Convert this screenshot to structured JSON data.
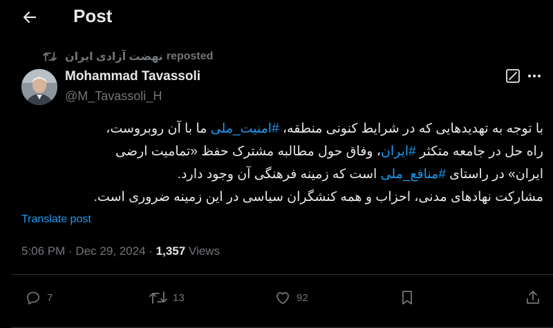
{
  "header": {
    "title": "Post"
  },
  "repost": {
    "label": "reposted",
    "by": "نهضت آزادی ایران"
  },
  "author": {
    "name": "Mohammad Tavassoli",
    "handle": "@M_Tavassoli_H"
  },
  "post": {
    "line1_a": "با توجه به تهدیدهایی که در شرایط کنونی منطقه، ",
    "line1_tag": "#امنیت_ملی",
    "line1_b": " ما با آن روبروست،",
    "line2_a": "راه حل در جامعه متکثر ",
    "line2_tag": "#ایران",
    "line2_b": "، وفاق حول مطالبه مشترک حفظ «تمامیت ارضی",
    "line3_a": "ایران» در راستای ",
    "line3_tag": "#منافع_ملی",
    "line3_b": " است که زمینه فرهنگی آن وجود دارد.",
    "line4": "مشارکت نهادهای مدنی، احزاب و همه کنشگران سیاسی در این زمینه ضروری است."
  },
  "translate": "Translate post",
  "meta": {
    "time": "5:06 PM",
    "sep": " · ",
    "date": "Dec 29, 2024",
    "views_count": "1,357",
    "views_label": "Views"
  },
  "actions": {
    "replies": "7",
    "reposts": "13",
    "likes": "92"
  },
  "icons": [
    "back-arrow-icon",
    "repost-icon",
    "grok-icon",
    "more-icon",
    "reply-icon",
    "like-icon",
    "bookmark-icon",
    "share-icon"
  ],
  "colors": {
    "background": "#000000",
    "text": "#e7e9ea",
    "muted": "#71767b",
    "accent": "#1d9bf0",
    "border": "#2f3336"
  }
}
